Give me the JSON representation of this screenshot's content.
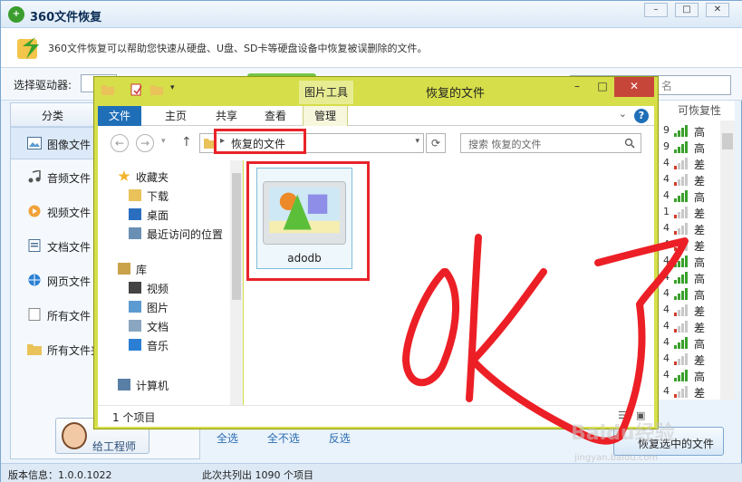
{
  "app": {
    "title": "360文件恢复",
    "description": "360文件恢复可以帮助您快速从硬盘、U盘、SD卡等硬盘设备中恢复被误删除的文件。",
    "drive_label": "选择驱动器:",
    "search_placeholder_tail": "名",
    "sidebar": {
      "header": "分类",
      "items": [
        {
          "label": "图像文件",
          "icon": "image-icon"
        },
        {
          "label": "音频文件",
          "icon": "music-icon"
        },
        {
          "label": "视频文件",
          "icon": "video-icon"
        },
        {
          "label": "文档文件",
          "icon": "document-icon"
        },
        {
          "label": "网页文件",
          "icon": "webpage-icon"
        },
        {
          "label": "所有文件",
          "icon": "folder-icon"
        },
        {
          "label": "所有文件夹",
          "icon": "folder-icon"
        }
      ]
    },
    "recoverability": {
      "header": "可恢复性",
      "rows": [
        {
          "num": "9",
          "level": "高"
        },
        {
          "num": "9",
          "level": "高"
        },
        {
          "num": "4",
          "level": "差"
        },
        {
          "num": "4",
          "level": "差"
        },
        {
          "num": "4",
          "level": "高"
        },
        {
          "num": "1",
          "level": "差"
        },
        {
          "num": "4",
          "level": "差"
        },
        {
          "num": "4",
          "level": "差"
        },
        {
          "num": "4",
          "level": "高"
        },
        {
          "num": "4",
          "level": "高"
        },
        {
          "num": "4",
          "level": "高"
        },
        {
          "num": "4",
          "level": "差"
        },
        {
          "num": "4",
          "level": "差"
        },
        {
          "num": "4",
          "level": "高"
        },
        {
          "num": "4",
          "level": "差"
        },
        {
          "num": "4",
          "level": "高"
        },
        {
          "num": "4",
          "level": "差"
        }
      ]
    },
    "engineer_button": "给工程师",
    "links": [
      "全选",
      "全不选",
      "反选"
    ],
    "recover_button": "恢复选中的文件",
    "status_version": "版本信息：1.0.0.1022",
    "status_count": "此次共列出 1090 个项目",
    "colors": {
      "high": "#3aa02c",
      "low": "#d33a2c",
      "accent": "#1f6fb8"
    }
  },
  "explorer": {
    "context_tab": "图片工具",
    "title": "恢复的文件",
    "ribbon_tabs": [
      "文件",
      "主页",
      "共享",
      "查看",
      "管理"
    ],
    "address": "恢复的文件",
    "search_placeholder": "搜索 恢复的文件",
    "nav": [
      {
        "label": "收藏夹",
        "icon": "star-icon",
        "indent": 0
      },
      {
        "label": "下载",
        "icon": "download-folder-icon",
        "indent": 1
      },
      {
        "label": "桌面",
        "icon": "desktop-icon",
        "indent": 1
      },
      {
        "label": "最近访问的位置",
        "icon": "recent-places-icon",
        "indent": 1
      },
      {
        "label": "库",
        "icon": "library-icon",
        "indent": 0
      },
      {
        "label": "视频",
        "icon": "video-library-icon",
        "indent": 1
      },
      {
        "label": "图片",
        "icon": "picture-library-icon",
        "indent": 1
      },
      {
        "label": "文档",
        "icon": "document-library-icon",
        "indent": 1
      },
      {
        "label": "音乐",
        "icon": "music-library-icon",
        "indent": 1
      },
      {
        "label": "计算机",
        "icon": "computer-icon",
        "indent": 0
      }
    ],
    "file": {
      "name": "adodb"
    },
    "status": "1 个项目"
  },
  "annotation": {
    "handwritten": "ok了"
  },
  "watermark": {
    "main": "Baidu经验",
    "sub": "jingyan.baidu.com"
  }
}
